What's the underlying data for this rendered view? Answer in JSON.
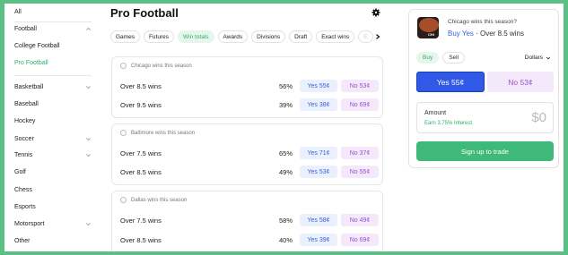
{
  "sidebar": {
    "items": [
      {
        "label": "All",
        "expandable": false,
        "active": false
      },
      {
        "label": "Football",
        "expandable": true,
        "expanded": true,
        "active": false
      },
      {
        "label": "College Football",
        "expandable": false,
        "active": false
      },
      {
        "label": "Pro Football",
        "expandable": false,
        "active": true
      },
      {
        "label": "Basketball",
        "expandable": true,
        "active": false
      },
      {
        "label": "Baseball",
        "expandable": false,
        "active": false
      },
      {
        "label": "Hockey",
        "expandable": false,
        "active": false
      },
      {
        "label": "Soccer",
        "expandable": true,
        "active": false
      },
      {
        "label": "Tennis",
        "expandable": true,
        "active": false
      },
      {
        "label": "Golf",
        "expandable": false,
        "active": false
      },
      {
        "label": "Chess",
        "expandable": false,
        "active": false
      },
      {
        "label": "Esports",
        "expandable": false,
        "active": false
      },
      {
        "label": "Motorsport",
        "expandable": true,
        "active": false
      },
      {
        "label": "Other",
        "expandable": false,
        "active": false
      }
    ]
  },
  "main": {
    "title": "Pro Football",
    "tabs": [
      {
        "label": "Games",
        "active": false
      },
      {
        "label": "Futures",
        "active": false
      },
      {
        "label": "Win totals",
        "active": true
      },
      {
        "label": "Awards",
        "active": false
      },
      {
        "label": "Divisions",
        "active": false
      },
      {
        "label": "Draft",
        "active": false
      },
      {
        "label": "Exact wins",
        "active": false
      },
      {
        "label": "E",
        "active": false
      }
    ],
    "cards": [
      {
        "heading": "Chicago wins this season",
        "rows": [
          {
            "label": "Over 8.5 wins",
            "pct": "56%",
            "yes": "Yes 55¢",
            "no": "No 53¢"
          },
          {
            "label": "Over 9.5 wins",
            "pct": "39%",
            "yes": "Yes 38¢",
            "no": "No 69¢"
          }
        ]
      },
      {
        "heading": "Baltimore wins this season",
        "rows": [
          {
            "label": "Over 7.5 wins",
            "pct": "65%",
            "yes": "Yes 71¢",
            "no": "No 37¢"
          },
          {
            "label": "Over 8.5 wins",
            "pct": "49%",
            "yes": "Yes 53¢",
            "no": "No 55¢"
          }
        ]
      },
      {
        "heading": "Dallas wins this season",
        "rows": [
          {
            "label": "Over 7.5 wins",
            "pct": "58%",
            "yes": "Yes 58¢",
            "no": "No 49¢"
          },
          {
            "label": "Over 8.5 wins",
            "pct": "40%",
            "yes": "Yes 39¢",
            "no": "No 69¢"
          }
        ]
      }
    ]
  },
  "panel": {
    "question": "Chicago wins this season?",
    "subtitle_action": "Buy Yes",
    "subtitle_rest": " · Over 8.5 wins",
    "thumb_tag": "CHI",
    "buy_label": "Buy",
    "sell_label": "Sell",
    "currency": "Dollars",
    "yes_label": "Yes  55¢",
    "no_label": "No  53¢",
    "amount_label": "Amount",
    "interest": "Earn 3.75% Interest",
    "amount_value": "$0",
    "signup": "Sign up to trade"
  },
  "colors": {
    "accent_green": "#2eaf6a",
    "yes_blue": "#2f59e6",
    "no_purple": "#9b4fd1",
    "border_green": "#5cbf85"
  }
}
